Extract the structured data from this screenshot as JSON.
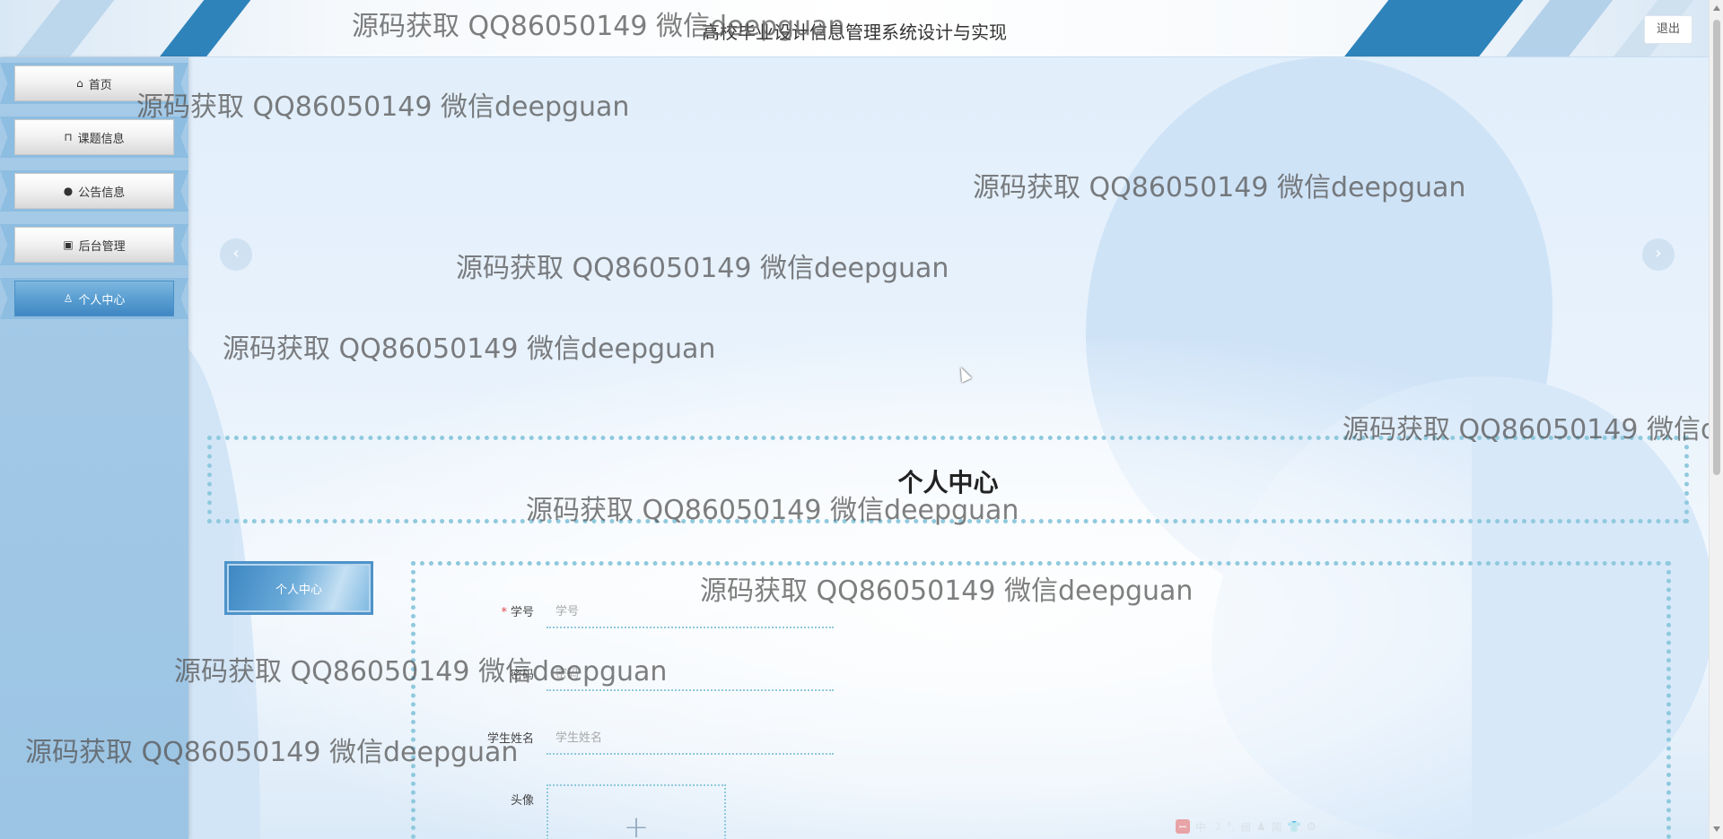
{
  "header": {
    "title": "高校毕业设计信息管理系统设计与实现",
    "logout_label": "退出"
  },
  "sidebar": {
    "items": [
      {
        "label": "首页",
        "icon": "home-icon"
      },
      {
        "label": "课题信息",
        "icon": "bag-icon"
      },
      {
        "label": "公告信息",
        "icon": "info-icon"
      },
      {
        "label": "后台管理",
        "icon": "gift-icon"
      },
      {
        "label": "个人中心",
        "icon": "user-icon",
        "active": true
      }
    ]
  },
  "carousel": {
    "prev_glyph": "‹",
    "next_glyph": "›"
  },
  "section": {
    "title": "个人中心"
  },
  "side_tab": {
    "label": "个人中心"
  },
  "form": {
    "fields": [
      {
        "label": "学号",
        "placeholder": "学号",
        "required": true
      },
      {
        "label": "密码",
        "placeholder": "密码",
        "required": false
      },
      {
        "label": "学生姓名",
        "placeholder": "学生姓名",
        "required": false
      }
    ],
    "avatar_label": "头像",
    "upload_glyph": "+"
  },
  "ime_toolbar": {
    "items": [
      "中",
      "☽",
      "°,",
      "▤",
      "♟",
      "简",
      "👕",
      "⚙"
    ]
  },
  "watermark": {
    "text": "源码获取 QQ86050149 微信deepguan"
  },
  "colors": {
    "accent": "#2f83bb",
    "dotted_border": "#8fc9dd",
    "sidebar_bg": "#a6cbe8",
    "required_star": "#e04848"
  }
}
